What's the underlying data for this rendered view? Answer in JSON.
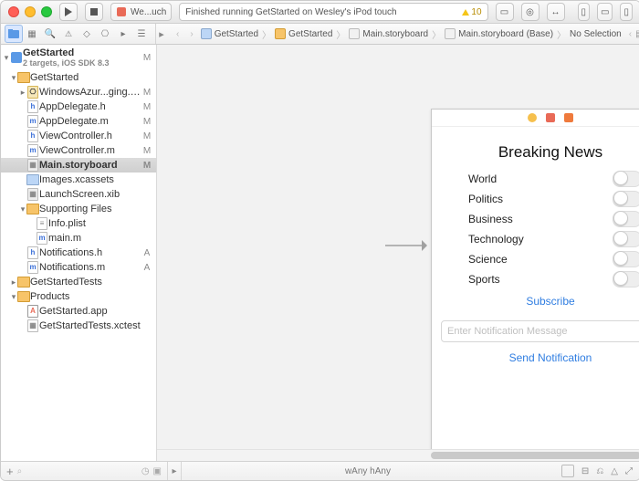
{
  "titlebar": {
    "tab_name": "We...uch",
    "status": "Finished running GetStarted on Wesley's iPod touch",
    "warning_count": "10"
  },
  "jumpbar": {
    "c1": "GetStarted",
    "c2": "GetStarted",
    "c3": "Main.storyboard",
    "c4": "Main.storyboard (Base)",
    "c5": "No Selection"
  },
  "project": {
    "name": "GetStarted",
    "subtitle": "2 targets, iOS SDK 8.3"
  },
  "files": {
    "f_root": "GetStarted",
    "f_wa": "WindowsAzur...ging.framework",
    "f_ad_h": "AppDelegate.h",
    "f_ad_m": "AppDelegate.m",
    "f_vc_h": "ViewController.h",
    "f_vc_m": "ViewController.m",
    "f_main": "Main.storyboard",
    "f_img": "Images.xcassets",
    "f_launch": "LaunchScreen.xib",
    "f_sup": "Supporting Files",
    "f_info": "Info.plist",
    "f_mainm": "main.m",
    "f_not_h": "Notifications.h",
    "f_not_m": "Notifications.m",
    "f_tests": "GetStartedTests",
    "f_prod": "Products",
    "f_app": "GetStarted.app",
    "f_xctest": "GetStartedTests.xctest"
  },
  "status": {
    "M": "M",
    "A": "A"
  },
  "storyboard": {
    "title": "Breaking News",
    "categories": [
      "World",
      "Politics",
      "Business",
      "Technology",
      "Science",
      "Sports"
    ],
    "subscribe": "Subscribe",
    "placeholder": "Enter Notification Message",
    "send": "Send Notification"
  },
  "bottom": {
    "size_class": "wAny hAny"
  }
}
